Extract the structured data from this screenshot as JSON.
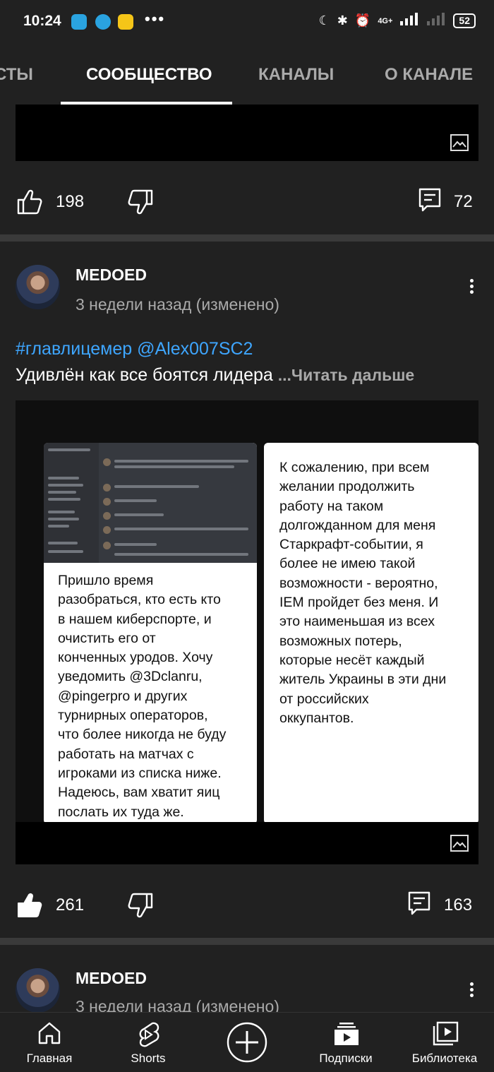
{
  "status_bar": {
    "time": "10:24",
    "network": "4G+",
    "battery": "52"
  },
  "tabs": [
    {
      "label": "СТЫ"
    },
    {
      "label": "СООБЩЕСТВО"
    },
    {
      "label": "КАНАЛЫ"
    },
    {
      "label": "О КАНАЛЕ"
    }
  ],
  "post1": {
    "likes": "198",
    "comments": "72"
  },
  "post2": {
    "author": "MEDOED",
    "date": "3 недели назад (изменено)",
    "tags": "#главлицемер @Alex007SC2",
    "text": "Удивлён как все боятся лидера ",
    "read_more": "...Читать дальше",
    "image_left_text": "Пришло время\nразобраться, кто есть кто\nв нашем киберспорте, и\nочистить его от\nконченных уродов. Хочу\nуведомить @3Dclanru,\n@pingerpro и других\nтурнирных операторов,\nчто более никогда не буду\nработать на матчах с\nигроками из списка ниже.\nНадеюсь, вам хватит яиц\nпослать их туда же.",
    "image_right_text": "К сожалению, при всем\nжелании продолжить\nработу на таком\nдолгожданном для меня\nСтаркрафт-событии, я\nболее не имею такой\nвозможности - вероятно,\nIEM пройдет без меня. И\nэто наименьшая из всех\nвозможных потерь,\nкоторые несёт каждый\nжитель Украины в эти дни\nот российских\nоккупантов.",
    "likes": "261",
    "comments": "163"
  },
  "post3": {
    "author": "MEDOED",
    "date": "3 недели назад (изменено)"
  },
  "nav": [
    {
      "label": "Главная",
      "icon": "home-icon"
    },
    {
      "label": "Shorts",
      "icon": "shorts-icon"
    },
    {
      "label": "",
      "icon": "create-icon"
    },
    {
      "label": "Подписки",
      "icon": "subscriptions-icon"
    },
    {
      "label": "Библиотека",
      "icon": "library-icon"
    }
  ],
  "colors": {
    "background": "#212121",
    "link": "#3ea6ff",
    "divider": "#3a3a3a"
  }
}
